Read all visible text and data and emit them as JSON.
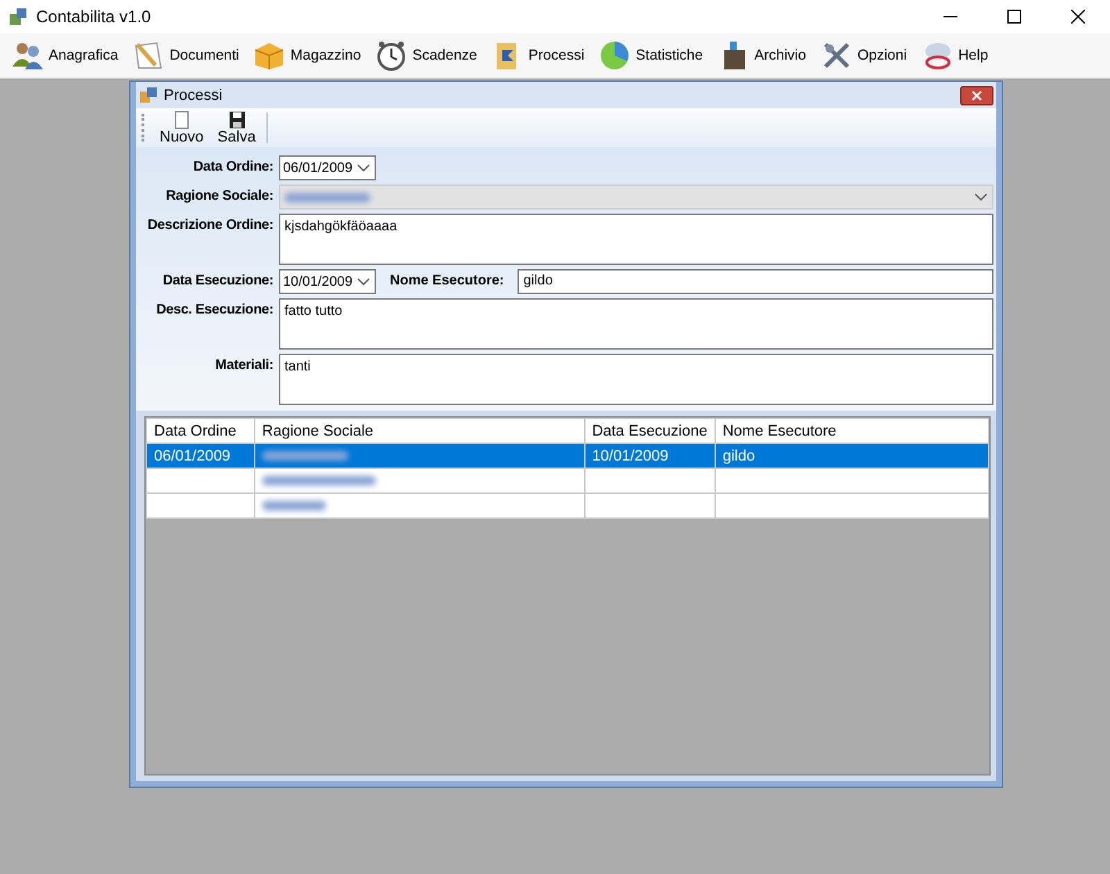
{
  "window": {
    "title": "Contabilita v1.0"
  },
  "menu": [
    "Anagrafica",
    "Documenti",
    "Magazzino",
    "Scadenze",
    "Processi",
    "Statistiche",
    "Archivio",
    "Opzioni",
    "Help"
  ],
  "child": {
    "title": "Processi",
    "toolbar": [
      "Nuovo",
      "Salva"
    ],
    "form": {
      "data_ordine": {
        "label": "Data Ordine:",
        "value": "06/01/2009"
      },
      "ragione_sociale": {
        "label": "Ragione Sociale:",
        "disabled": true,
        "blurred": true
      },
      "descrizione_ordine": {
        "label": "Descrizione Ordine:",
        "value": "kjsdahgökfäöaaaa"
      },
      "data_esecuzione": {
        "label": "Data Esecuzione:",
        "value": "10/01/2009"
      },
      "nome_esecutore": {
        "label": "Nome Esecutore:",
        "value": "gildo"
      },
      "desc_esecuzione": {
        "label": "Desc. Esecuzione:",
        "value": "fatto tutto"
      },
      "materiali": {
        "label": "Materiali:",
        "value": "tanti"
      }
    },
    "grid": {
      "columns": [
        "Data Ordine",
        "Ragione Sociale",
        "Data Esecuzione",
        "Nome Esecutore"
      ],
      "rows": [
        {
          "selected": true,
          "cells": [
            {
              "text": "06/01/2009"
            },
            {
              "blurred": true
            },
            {
              "text": "10/01/2009"
            },
            {
              "text": "gildo"
            }
          ]
        },
        {
          "selected": false,
          "cells": [
            {},
            {
              "blurred": true
            },
            {},
            {}
          ]
        },
        {
          "selected": false,
          "cells": [
            {},
            {
              "blurred": true
            },
            {},
            {}
          ]
        }
      ]
    }
  }
}
